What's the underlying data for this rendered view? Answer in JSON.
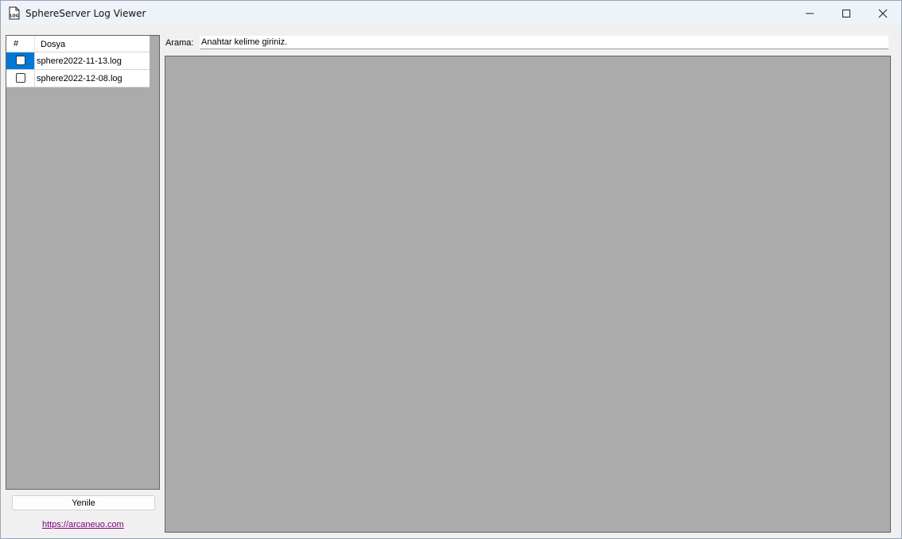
{
  "window": {
    "title": "SphereServer Log Viewer",
    "icon_text": "LOG",
    "controls": {
      "minimize": "minimize",
      "maximize": "maximize",
      "close": "close"
    }
  },
  "file_list": {
    "columns": [
      "#",
      "Dosya"
    ],
    "rows": [
      {
        "name": "sphere2022-11-13.log",
        "checked": false,
        "selected": true
      },
      {
        "name": "sphere2022-12-08.log",
        "checked": false,
        "selected": false
      }
    ]
  },
  "refresh_label": "Yenile",
  "link_text": "https://arcaneuo.com",
  "search": {
    "label": "Arama:",
    "placeholder": "Anahtar kelime giriniz."
  },
  "colors": {
    "selection": "#0078d7",
    "panel_bg": "#ababab",
    "link": "#800080"
  }
}
